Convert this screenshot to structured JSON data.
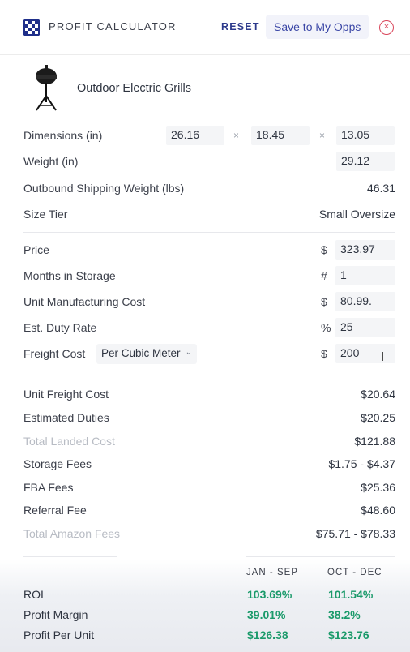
{
  "header": {
    "title": "PROFIT CALCULATOR",
    "reset_label": "RESET",
    "save_label": "Save to My Opps",
    "close_glyph": "×"
  },
  "product": {
    "name": "Outdoor Electric Grills",
    "image_icon": "grill-icon"
  },
  "dimensions": {
    "label": "Dimensions (in)",
    "values": [
      "26.16",
      "18.45",
      "13.05"
    ],
    "separator": "×"
  },
  "weight": {
    "label": "Weight (in)",
    "value": "29.12"
  },
  "shipping_weight": {
    "label": "Outbound Shipping Weight (lbs)",
    "value": "46.31"
  },
  "size_tier": {
    "label": "Size Tier",
    "value": "Small Oversize"
  },
  "inputs": {
    "price": {
      "label": "Price",
      "prefix": "$",
      "value": "323.97"
    },
    "months_storage": {
      "label": "Months in Storage",
      "prefix": "#",
      "value": "1"
    },
    "unit_mfg_cost": {
      "label": "Unit Manufacturing Cost",
      "prefix": "$",
      "value": "80.99."
    },
    "duty_rate": {
      "label": "Est. Duty Rate",
      "prefix": "%",
      "value": "25"
    },
    "freight_cost": {
      "label": "Freight Cost",
      "prefix": "$",
      "value": "200",
      "mode": "Per Cubic Meter"
    }
  },
  "results": {
    "unit_freight_cost": {
      "label": "Unit Freight Cost",
      "value": "$20.64"
    },
    "estimated_duties": {
      "label": "Estimated Duties",
      "value": "$20.25"
    },
    "total_landed_cost": {
      "label": "Total Landed Cost",
      "value": "$121.88"
    },
    "storage_fees": {
      "label": "Storage Fees",
      "value": "$1.75 - $4.37"
    },
    "fba_fees": {
      "label": "FBA Fees",
      "value": "$25.36"
    },
    "referral_fee": {
      "label": "Referral Fee",
      "value": "$48.60"
    },
    "total_amazon_fees": {
      "label": "Total Amazon Fees",
      "value": "$75.71 - $78.33"
    }
  },
  "summary": {
    "columns": [
      "JAN - SEP",
      "OCT - DEC"
    ],
    "rows": [
      {
        "label": "ROI",
        "values": [
          "103.69%",
          "101.54%"
        ]
      },
      {
        "label": "Profit Margin",
        "values": [
          "39.01%",
          "38.2%"
        ]
      },
      {
        "label": "Profit Per Unit",
        "values": [
          "$126.38",
          "$123.76"
        ]
      }
    ]
  },
  "colors": {
    "accent": "#2d3a8c",
    "positive": "#1a9a6a",
    "close": "#d9455a"
  }
}
